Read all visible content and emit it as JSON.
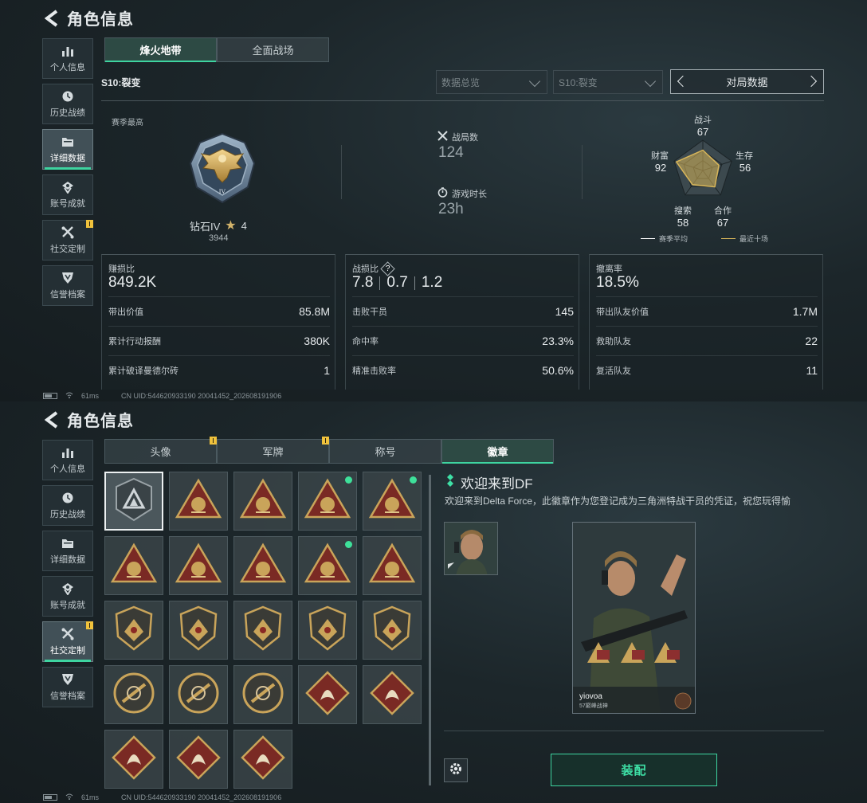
{
  "top": {
    "title": "角色信息",
    "sidebar": [
      {
        "label": "个人信息",
        "icon": "bar-chart-icon",
        "active": false
      },
      {
        "label": "历史战绩",
        "icon": "clock-icon",
        "active": false
      },
      {
        "label": "详细数据",
        "icon": "folder-icon",
        "active": true
      },
      {
        "label": "账号成就",
        "icon": "medal-icon",
        "active": false
      },
      {
        "label": "社交定制",
        "icon": "wrench-icon",
        "active": false,
        "notice": true
      },
      {
        "label": "信誉档案",
        "icon": "shield-icon",
        "active": false
      }
    ],
    "tabs": [
      {
        "label": "烽火地带",
        "active": true
      },
      {
        "label": "全面战场",
        "active": false
      }
    ],
    "season_title": "S10:裂变",
    "select_overview": "数据总览",
    "select_season": "S10:裂变",
    "pager_label": "对局数据",
    "season_best_label": "赛季最高",
    "rank_name": "钻石IV",
    "rank_stars": "4",
    "rank_score": "3944",
    "matches_label": "战局数",
    "matches_value": "124",
    "playtime_label": "游戏时长",
    "playtime_value": "23h",
    "radar": {
      "labels": {
        "combat": "战斗",
        "survival": "生存",
        "cooperation": "合作",
        "search": "搜索",
        "wealth": "财富"
      },
      "values": {
        "combat": "67",
        "survival": "56",
        "cooperation": "67",
        "search": "58",
        "wealth": "92"
      },
      "legend_avg": "赛季平均",
      "legend_recent": "最近十场",
      "avg_color": "#ffffff",
      "recent_color": "#d8b65a"
    },
    "cards": [
      {
        "title": "赚损比",
        "big": "849.2K",
        "rows": [
          {
            "k": "带出价值",
            "v": "85.8M"
          },
          {
            "k": "累计行动报酬",
            "v": "380K"
          },
          {
            "k": "累计破译曼德尔砖",
            "v": "1"
          }
        ]
      },
      {
        "title": "战损比",
        "big_parts": [
          "7.8",
          "0.7",
          "1.2"
        ],
        "help": "?",
        "rows": [
          {
            "k": "击败干员",
            "v": "145"
          },
          {
            "k": "命中率",
            "v": "23.3%"
          },
          {
            "k": "精准击败率",
            "v": "50.6%"
          }
        ]
      },
      {
        "title": "撤离率",
        "big": "18.5%",
        "rows": [
          {
            "k": "带出队友价值",
            "v": "1.7M"
          },
          {
            "k": "救助队友",
            "v": "22"
          },
          {
            "k": "复活队友",
            "v": "11"
          }
        ]
      }
    ],
    "status": {
      "ping": "61ms",
      "uid": "CN UID:544620933190 20041452_202608191906"
    }
  },
  "bottom": {
    "title": "角色信息",
    "sidebar": [
      {
        "label": "个人信息",
        "icon": "bar-chart-icon",
        "active": false
      },
      {
        "label": "历史战绩",
        "icon": "clock-icon",
        "active": false
      },
      {
        "label": "详细数据",
        "icon": "folder-icon",
        "active": false
      },
      {
        "label": "账号成就",
        "icon": "medal-icon",
        "active": false
      },
      {
        "label": "社交定制",
        "icon": "wrench-icon",
        "active": true,
        "notice": true
      },
      {
        "label": "信誉档案",
        "icon": "shield-icon",
        "active": false
      }
    ],
    "tabs": [
      {
        "label": "头像",
        "active": false,
        "notice": true
      },
      {
        "label": "军牌",
        "active": false,
        "notice": true
      },
      {
        "label": "称号",
        "active": false
      },
      {
        "label": "徽章",
        "active": true
      }
    ],
    "badges": [
      {
        "icon": "delta-force-badge-icon",
        "new": false,
        "selected": true
      },
      {
        "icon": "helicopter-badge-icon",
        "new": false
      },
      {
        "icon": "hand-sign-badge-icon",
        "new": false
      },
      {
        "icon": "tank-badge-icon",
        "new": true
      },
      {
        "icon": "operator-helmet-badge-icon",
        "new": true
      },
      {
        "icon": "eri-badge-icon",
        "new": false
      },
      {
        "icon": "boonie-hat-badge-icon",
        "new": false
      },
      {
        "icon": "number-one-badge-icon",
        "new": false
      },
      {
        "icon": "usb-drive-badge-icon",
        "new": true
      },
      {
        "icon": "squad-badge-icon",
        "new": false
      },
      {
        "icon": "rose-badge-icon",
        "new": false
      },
      {
        "icon": "star-shield-badge-icon",
        "new": false
      },
      {
        "icon": "chevron-shield-badge-icon",
        "new": false
      },
      {
        "icon": "stars-crest-badge-icon",
        "new": false
      },
      {
        "icon": "hexagon-shield-badge-icon",
        "new": false
      },
      {
        "icon": "shell-badge-icon",
        "new": false
      },
      {
        "icon": "rifle-badge-icon",
        "new": false
      },
      {
        "icon": "crossed-sword-crest-badge-icon",
        "new": false
      },
      {
        "icon": "wolf-badge-icon",
        "new": false
      },
      {
        "icon": "dragon-badge-icon",
        "new": false
      },
      {
        "icon": "runner-badge-icon",
        "new": false
      },
      {
        "icon": "horse-badge-icon",
        "new": false
      },
      {
        "icon": "knife-badge-icon",
        "new": false
      }
    ],
    "detail_title": "欢迎来到DF",
    "detail_desc": "欢迎来到Delta Force，此徽章作为您登记成为三角洲特战干员的凭证，祝您玩得愉",
    "card_name": "yiovoa",
    "card_sub": "57巅峰战神",
    "equip_label": "装配",
    "status": {
      "ping": "61ms",
      "uid": "CN UID:544620933190 20041452_202608191906"
    }
  }
}
